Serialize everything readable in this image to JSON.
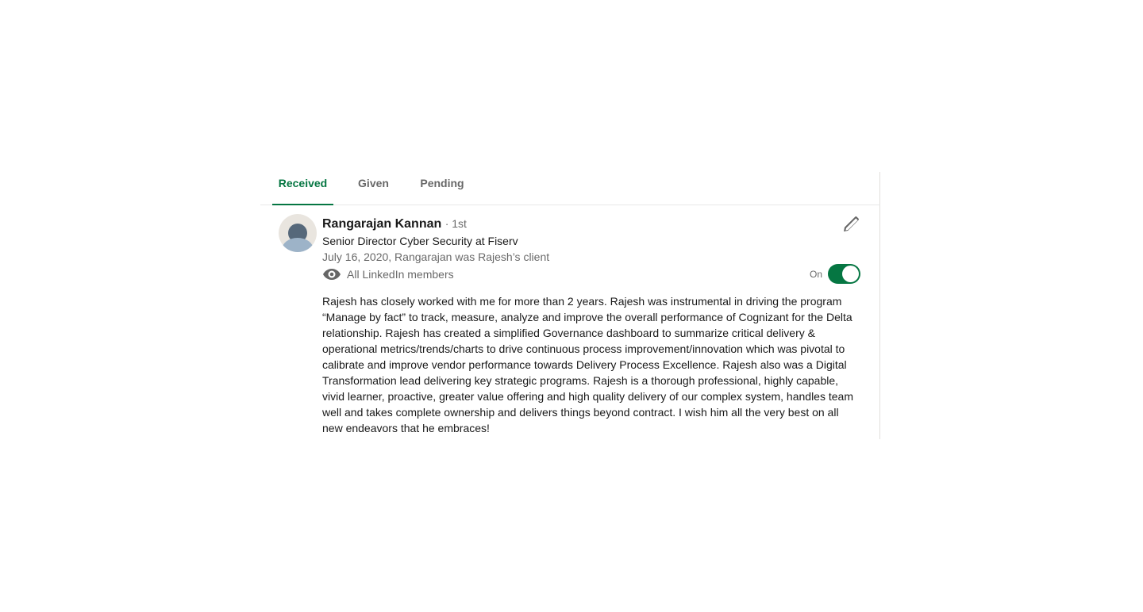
{
  "tabs": [
    {
      "label": "Received",
      "active": true
    },
    {
      "label": "Given",
      "active": false
    },
    {
      "label": "Pending",
      "active": false
    }
  ],
  "recommendation": {
    "recommender_name": "Rangarajan Kannan",
    "connection_degree": "· 1st",
    "headline": "Senior Director Cyber Security at Fiserv",
    "relationship": "July 16, 2020, Rangarajan was Rajesh’s client",
    "visibility": "All LinkedIn members",
    "visibility_icon": "eye-icon",
    "toggle_label": "On",
    "toggle_on": true,
    "text": "Rajesh has closely worked with me for more than 2 years. Rajesh was instrumental in driving the program “Manage by fact” to track, measure, analyze and improve the overall performance of Cognizant for the Delta relationship. Rajesh has created a simplified Governance dashboard to summarize critical delivery & operational metrics/trends/charts to drive continuous process improvement/innovation which was pivotal to calibrate and improve vendor performance towards Delivery Process Excellence. Rajesh also was a Digital Transformation lead delivering key strategic programs. Rajesh is a thorough professional, highly capable, vivid learner, proactive, greater value offering and high quality delivery of our complex system, handles team well and takes complete ownership and delivers things beyond contract. I wish him all the very best on all new endeavors that he embraces!"
  },
  "colors": {
    "accent": "#057642",
    "muted_text": "rgba(0,0,0,0.6)",
    "divider": "#e0dfdc"
  }
}
